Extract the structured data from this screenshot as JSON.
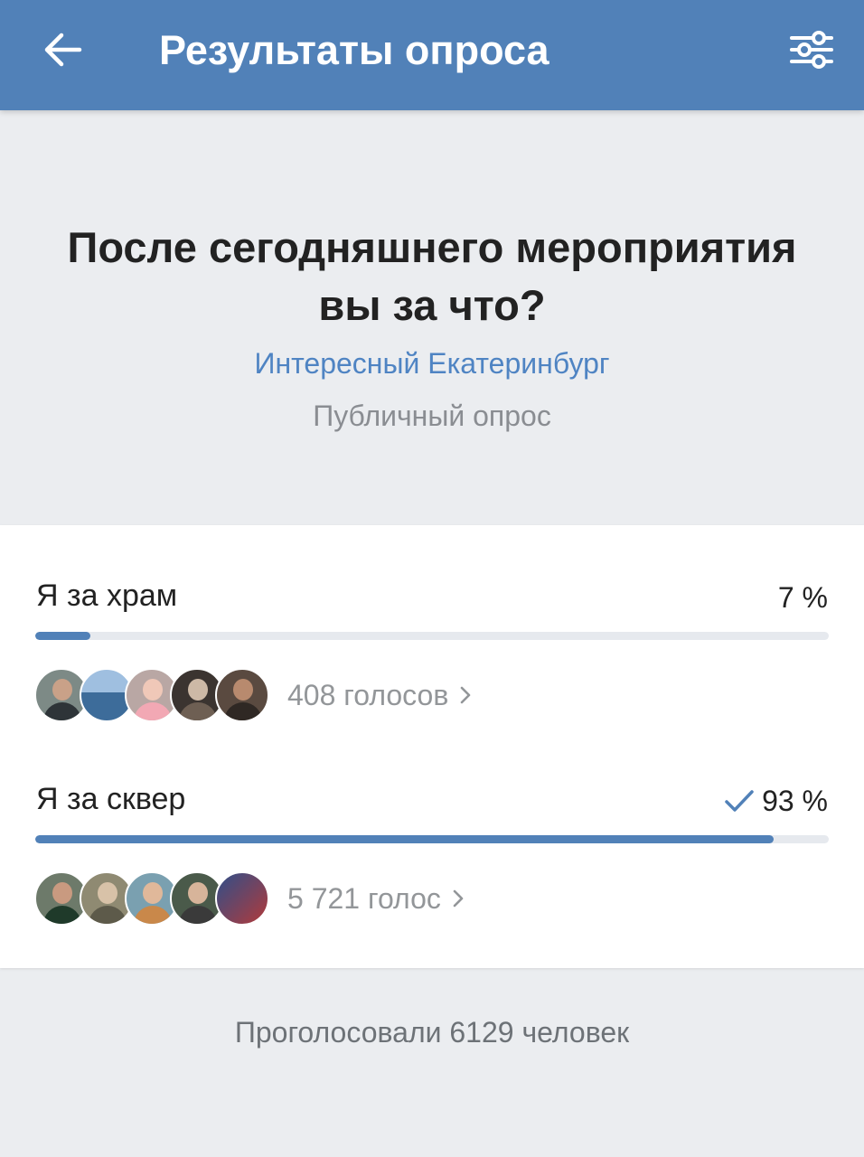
{
  "header": {
    "title": "Результаты опроса",
    "back_icon": "arrow-left-icon",
    "filter_icon": "sliders-icon",
    "bg_color": "#5181b8"
  },
  "poll": {
    "question": "После сегодняшнего мероприятия вы за что?",
    "owner": "Интересный Екатеринбург",
    "type": "Публичный опрос"
  },
  "options": [
    {
      "label": "Я за храм",
      "percent_text": "7 %",
      "percent": 7,
      "votes_text": "408 голосов",
      "voted": false
    },
    {
      "label": "Я за сквер",
      "percent_text": "93 %",
      "percent": 93,
      "votes_text": "5 721 голос",
      "voted": true
    }
  ],
  "footer": {
    "total_text": "Проголосовали 6129 человек"
  },
  "colors": {
    "accent": "#5181b8",
    "link": "#4f84c3",
    "bar_track": "#e6e9ee",
    "background": "#ebedf0"
  }
}
